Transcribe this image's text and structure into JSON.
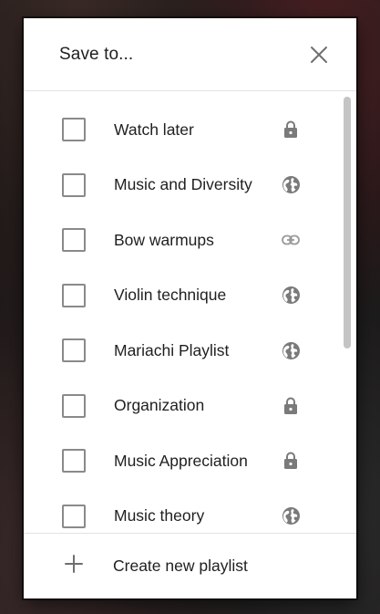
{
  "dialog": {
    "title": "Save to...",
    "close_icon": "close-icon"
  },
  "playlists": [
    {
      "label": "Watch later",
      "checked": false,
      "privacy": "private",
      "icon": "lock-icon"
    },
    {
      "label": "Music and Diversity",
      "checked": false,
      "privacy": "public",
      "icon": "globe-icon"
    },
    {
      "label": "Bow warmups",
      "checked": false,
      "privacy": "unlisted",
      "icon": "link-icon"
    },
    {
      "label": "Violin technique",
      "checked": false,
      "privacy": "public",
      "icon": "globe-icon"
    },
    {
      "label": "Mariachi Playlist",
      "checked": false,
      "privacy": "public",
      "icon": "globe-icon"
    },
    {
      "label": "Organization",
      "checked": false,
      "privacy": "private",
      "icon": "lock-icon"
    },
    {
      "label": "Music Appreciation",
      "checked": false,
      "privacy": "private",
      "icon": "lock-icon"
    },
    {
      "label": "Music theory",
      "checked": false,
      "privacy": "public",
      "icon": "globe-icon"
    }
  ],
  "footer": {
    "create_label": "Create new playlist",
    "icon": "plus-icon"
  },
  "colors": {
    "text": "#1f1f1f",
    "icon": "#7a7a7a",
    "checkbox_border": "#8a8a8a",
    "divider": "#e2e2e2"
  }
}
